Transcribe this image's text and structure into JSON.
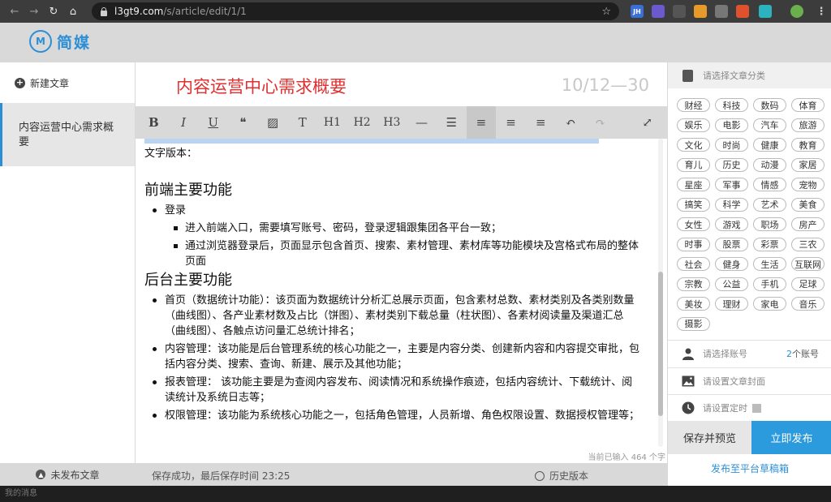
{
  "browser": {
    "url_host": "l3gt9.com",
    "url_path": "/s/article/edit/1/1",
    "extensions": [
      {
        "name": "jh-extension-icon",
        "label": "JH",
        "color": "#3b6fd6"
      },
      {
        "name": "globe-extension-icon",
        "label": "",
        "color": "#6a5acd"
      },
      {
        "name": "react-extension-icon",
        "label": "",
        "color": "#555555"
      },
      {
        "name": "mail-extension-icon",
        "label": "",
        "color": "#e59a2a"
      },
      {
        "name": "qr-extension-icon",
        "label": "",
        "color": "#777777"
      },
      {
        "name": "block-extension-icon",
        "label": "",
        "color": "#e0522d"
      },
      {
        "name": "chat-extension-icon",
        "label": "",
        "color": "#2bb3c0"
      },
      {
        "name": "avatar-extension-icon",
        "label": "",
        "color": "#6ab04c"
      }
    ]
  },
  "app": {
    "logo_mark": "M",
    "logo_text": "简媒"
  },
  "sidebar": {
    "new_article": "新建文章",
    "doc_title": "内容运营中心需求概要",
    "footer": "未发布文章"
  },
  "editor": {
    "title": "内容运营中心需求概要",
    "title_count": "10/12—30",
    "toolbar": [
      {
        "name": "bold-button",
        "glyph": "B"
      },
      {
        "name": "italic-button",
        "glyph": "I"
      },
      {
        "name": "underline-button",
        "glyph": "U"
      },
      {
        "name": "quote-button",
        "glyph": "❝"
      },
      {
        "name": "image-button",
        "glyph": "▨"
      },
      {
        "name": "text-style-button",
        "glyph": "T"
      },
      {
        "name": "h1-button",
        "glyph": "H1"
      },
      {
        "name": "h2-button",
        "glyph": "H2"
      },
      {
        "name": "h3-button",
        "glyph": "H3"
      },
      {
        "name": "divider-button",
        "glyph": "—"
      },
      {
        "name": "list-button",
        "glyph": "☰"
      },
      {
        "name": "align-left-button",
        "glyph": "≡"
      },
      {
        "name": "align-center-button",
        "glyph": "≡"
      },
      {
        "name": "align-right-button",
        "glyph": "≡"
      },
      {
        "name": "undo-button",
        "glyph": "↶"
      },
      {
        "name": "redo-button",
        "glyph": "↷"
      }
    ],
    "expand_glyph": "⤢",
    "text_version": "文字版本：",
    "h_front": "前端主要功能",
    "front_login": "登录",
    "front_sub1": "进入前端入口，需要填写账号、密码，登录逻辑跟集团各平台一致；",
    "front_sub2": "通过浏览器登录后，页面显示包含首页、搜索、素材管理、素材库等功能模块及宫格式布局的整体页面",
    "h_back": "后台主要功能",
    "back_items": [
      "首页（数据统计功能）：该页面为数据统计分析汇总展示页面，包含素材总数、素材类别及各类别数量（曲线图）、各产业素材数及占比（饼图）、素材类别下载总量（柱状图）、各素材阅读量及渠道汇总（曲线图）、各触点访问量汇总统计排名；",
      "内容管理：该功能是后台管理系统的核心功能之一，主要是内容分类、创建新内容和内容提交审批，包括内容分类、搜索、查询、新建、展示及其他功能；",
      "报表管理： 该功能主要是为查阅内容发布、阅读情况和系统操作痕迹，包括内容统计、下载统计、阅读统计及系统日志等；",
      "权限管理：该功能为系统核心功能之一，包括角色管理，人员新增、角色权限设置、数据授权管理等；"
    ],
    "char_count": "当前已输入 464 个字"
  },
  "footer": {
    "save_status": "保存成功，最后保存时间 23:25",
    "history": "历史版本"
  },
  "right": {
    "category_placeholder": "请选择文章分类",
    "tags": [
      "财经",
      "科技",
      "数码",
      "体育",
      "娱乐",
      "电影",
      "汽车",
      "旅游",
      "文化",
      "时尚",
      "健康",
      "教育",
      "育儿",
      "历史",
      "动漫",
      "家居",
      "星座",
      "军事",
      "情感",
      "宠物",
      "搞笑",
      "科学",
      "艺术",
      "美食",
      "女性",
      "游戏",
      "职场",
      "房产",
      "时事",
      "股票",
      "彩票",
      "三农",
      "社会",
      "健身",
      "生活",
      "互联网",
      "宗教",
      "公益",
      "手机",
      "足球",
      "美妆",
      "理财",
      "家电",
      "音乐",
      "摄影"
    ],
    "account_label": "请选择账号",
    "account_count_num": "2",
    "account_count_suffix": "个账号",
    "cover_label": "请设置文章封面",
    "schedule_label": "请设置定时",
    "preview_button": "保存并预览",
    "publish_button": "立即发布",
    "draft_link": "发布至平台草稿箱"
  },
  "bottom": {
    "messages": "我的消息"
  }
}
